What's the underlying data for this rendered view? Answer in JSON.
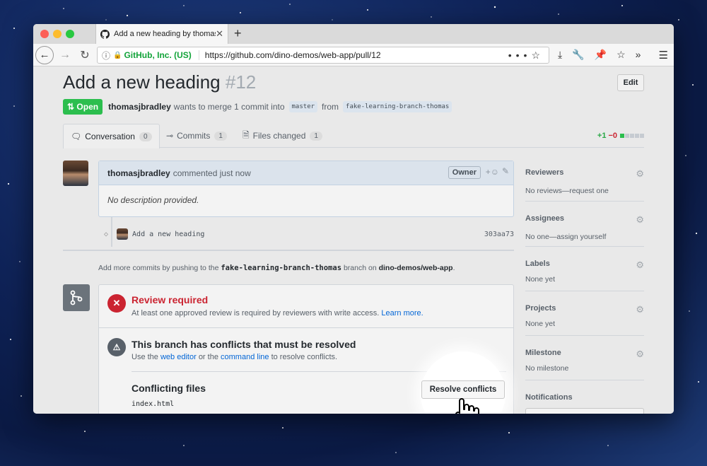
{
  "browser": {
    "tab_title": "Add a new heading by thomasjb",
    "cert_label": "GitHub, Inc. (US)",
    "url": "https://github.com/dino-demos/web-app/pull/12",
    "url_actions": "•••",
    "colors": {
      "close": "#fc5f57",
      "minimize": "#fdbc2e",
      "zoom": "#28c840",
      "secure": "#12a339"
    }
  },
  "pr": {
    "title": "Add a new heading",
    "number": "#12",
    "edit_label": "Edit",
    "state": "Open",
    "author": "thomasjbradley",
    "merge_text": "wants to merge 1 commit into",
    "base_branch": "master",
    "from_text": "from",
    "head_branch": "fake-learning-branch-thomas"
  },
  "tabs": [
    {
      "label": "Conversation",
      "count": "0"
    },
    {
      "label": "Commits",
      "count": "1"
    },
    {
      "label": "Files changed",
      "count": "1"
    }
  ],
  "diffstat": {
    "added": "+1",
    "removed": "−0"
  },
  "comment": {
    "author": "thomasjbradley",
    "action": "commented just now",
    "owner_label": "Owner",
    "reaction": "+☺",
    "body": "No description provided."
  },
  "commit": {
    "message": "Add a new heading",
    "sha": "303aa73"
  },
  "push_note": {
    "prefix": "Add more commits by pushing to the",
    "branch": "fake-learning-branch-thomas",
    "middle": "branch on",
    "repo": "dino-demos/web-app",
    "suffix": "."
  },
  "merge": {
    "review_title": "Review required",
    "review_text": "At least one approved review is required by reviewers with write access.",
    "review_link": "Learn more.",
    "conflict_title": "This branch has conflicts that must be resolved",
    "conflict_use": "Use the",
    "web_editor": "web editor",
    "or_the": "or the",
    "command_line": "command line",
    "to_resolve": "to resolve conflicts.",
    "resolve_button": "Resolve conflicts",
    "files_title": "Conflicting files",
    "files": [
      "index.html"
    ]
  },
  "sidebar": [
    {
      "title": "Reviewers",
      "value": "No reviews—request one"
    },
    {
      "title": "Assignees",
      "value": "No one—assign yourself"
    },
    {
      "title": "Labels",
      "value": "None yet"
    },
    {
      "title": "Projects",
      "value": "None yet"
    },
    {
      "title": "Milestone",
      "value": "No milestone"
    },
    {
      "title": "Notifications",
      "value": ""
    }
  ]
}
